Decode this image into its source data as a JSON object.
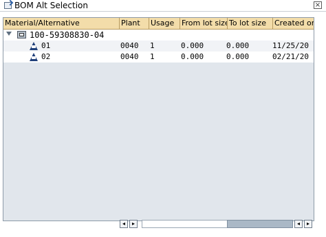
{
  "window": {
    "title": "BOM Alt Selection",
    "close_symbol": "×"
  },
  "columns": [
    {
      "label": "Material/Alternative"
    },
    {
      "label": "Plant"
    },
    {
      "label": "Usage"
    },
    {
      "label": "From lot size"
    },
    {
      "label": "To lot size"
    },
    {
      "label": "Created on"
    }
  ],
  "material": {
    "number": "100-59308830-04"
  },
  "rows": [
    {
      "alt": "01",
      "plant": "0040",
      "usage": "1",
      "from_lot": "0.000",
      "to_lot": "0.000",
      "created_on": "11/25/20"
    },
    {
      "alt": "02",
      "plant": "0040",
      "usage": "1",
      "from_lot": "0.000",
      "to_lot": "0.000",
      "created_on": "02/21/20"
    }
  ],
  "scrollbar": {
    "left_symbol": "◂",
    "right_symbol": "▸"
  }
}
